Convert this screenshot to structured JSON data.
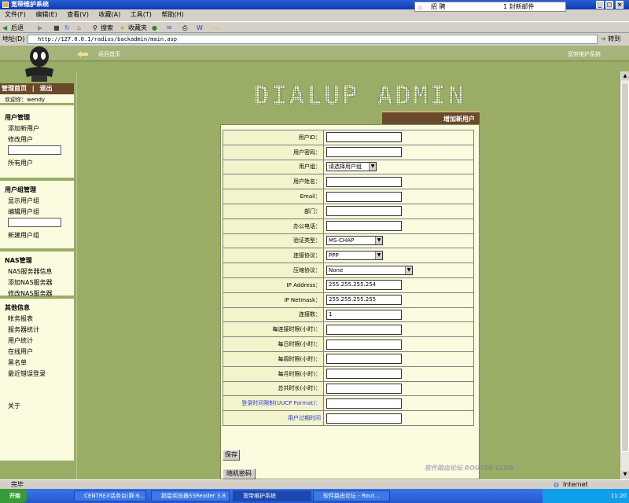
{
  "window": {
    "title": "宽带维护系统",
    "ad_text": "招 聘",
    "ad_badge": "1 封新邮件"
  },
  "menu": [
    "文件(F)",
    "编辑(E)",
    "查看(V)",
    "收藏(A)",
    "工具(T)",
    "帮助(H)"
  ],
  "toolbar": {
    "back": "后退",
    "search": "搜索",
    "favorites": "收藏夹"
  },
  "address": {
    "label": "地址(D)",
    "url": "http://127.0.0.1/radius/backadmin/main.asp",
    "go": "转到"
  },
  "page": {
    "back_link": "返回首页",
    "site_name": "宽带维护系统",
    "banner": "DIALUP ADMIN",
    "tab": "增加新用户"
  },
  "sidebar": {
    "nav_home": "管理首页",
    "nav_sep": "|",
    "nav_logout": "退出",
    "welcome": "欢迎你：wendy",
    "users": {
      "title": "用户管理",
      "add": "添加新用户",
      "edit": "修改用户",
      "all": "所有用户"
    },
    "groups": {
      "title": "用户组管理",
      "show": "显示用户组",
      "edit": "编辑用户组",
      "new": "新建用户组"
    },
    "nas": {
      "title": "NAS管理",
      "info": "NAS服务器信息",
      "add": "添加NAS服务器",
      "edit": "修改NAS服务器"
    },
    "other": {
      "title": "其他信息",
      "billing": "帐务报表",
      "stats": "服务器统计",
      "user_stats": "用户统计",
      "online": "在线用户",
      "blacklist": "黑名单",
      "errors": "最近错误登录",
      "about": "关于"
    }
  },
  "form": {
    "fields": [
      {
        "label": "用户ID：",
        "type": "input",
        "value": ""
      },
      {
        "label": "用户密码：",
        "type": "input",
        "value": ""
      },
      {
        "label": "用户组：",
        "type": "select",
        "value": "请选择用户组"
      },
      {
        "label": "用户姓名：",
        "type": "input",
        "value": ""
      },
      {
        "label": "Email：",
        "type": "input",
        "value": ""
      },
      {
        "label": "部门：",
        "type": "input",
        "value": ""
      },
      {
        "label": "办公电话：",
        "type": "input",
        "value": ""
      },
      {
        "label": "验证类型：",
        "type": "select",
        "value": "MS-CHAP"
      },
      {
        "label": "连接协议：",
        "type": "select",
        "value": "PPP"
      },
      {
        "label": "压缩协议：",
        "type": "select",
        "value": "None"
      },
      {
        "label": "IP Address：",
        "type": "input",
        "value": "255.255.255.254"
      },
      {
        "label": "IP Netmask：",
        "type": "input",
        "value": "255.255.255.255"
      },
      {
        "label": "连接数：",
        "type": "input",
        "value": "1"
      },
      {
        "label": "每连接时限(小时)：",
        "type": "input",
        "value": ""
      },
      {
        "label": "每日时限(小时)：",
        "type": "input",
        "value": ""
      },
      {
        "label": "每周时限(小时)：",
        "type": "input",
        "value": ""
      },
      {
        "label": "每月时限(小时)：",
        "type": "input",
        "value": ""
      },
      {
        "label": "总共时长(小时)：",
        "type": "input",
        "value": ""
      },
      {
        "label": "登录时间限制(UUCP Format)：",
        "type": "input",
        "value": ""
      },
      {
        "label": "用户过期时间",
        "type": "input",
        "value": ""
      }
    ],
    "save": "保存",
    "random_pw": "随机密码"
  },
  "status": {
    "text": "完毕",
    "zone": "Internet"
  },
  "taskbar": {
    "start": "开始",
    "tasks": [
      "CENTREX话务台(群:6...",
      "超星阅览器SSReader 3.8",
      "宽带维护系统",
      "软件路由论坛 - Rout..."
    ],
    "clock": "11:20"
  },
  "watermark": "软件路由论坛 ROUTER CLUB"
}
